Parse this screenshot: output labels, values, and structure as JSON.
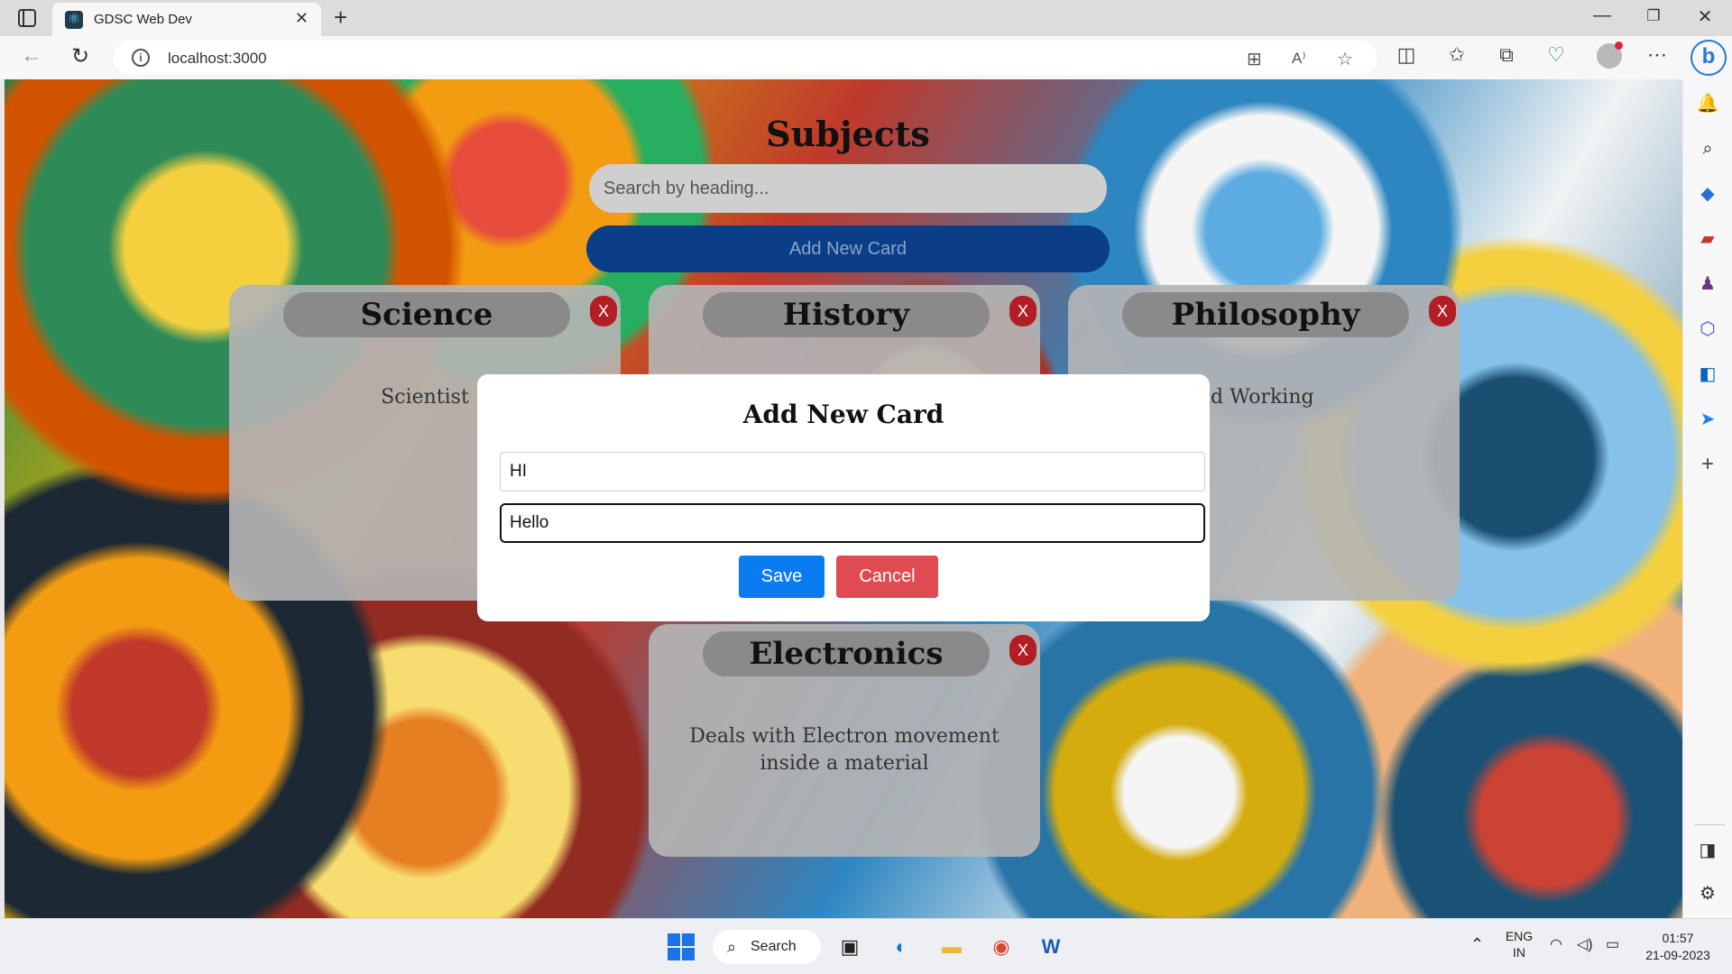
{
  "browser": {
    "tab_title": "GDSC Web Dev",
    "url": "localhost:3000",
    "new_tab": "+",
    "close_tab": "✕"
  },
  "page": {
    "title": "Subjects",
    "search_placeholder": "Search by heading...",
    "add_button": "Add New Card",
    "cards": [
      {
        "heading": "Science",
        "body": "Scientist",
        "close": "X"
      },
      {
        "heading": "History",
        "body": "",
        "close": "X"
      },
      {
        "heading": "Philosophy",
        "body": "an Mind Working",
        "close": "X"
      },
      {
        "heading": "Electronics",
        "body": "Deals with Electron movement inside a material",
        "close": "X"
      }
    ]
  },
  "modal": {
    "title": "Add New Card",
    "heading_value": "HI",
    "body_value": "Hello",
    "save": "Save",
    "cancel": "Cancel"
  },
  "taskbar": {
    "search": "Search",
    "lang_top": "ENG",
    "lang_bottom": "IN",
    "time": "01:57",
    "date": "21-09-2023"
  },
  "colors": {
    "save": "#0a7cf2",
    "cancel": "#df4b50",
    "add_button": "#0a3f88",
    "card_close": "#b31d24"
  }
}
